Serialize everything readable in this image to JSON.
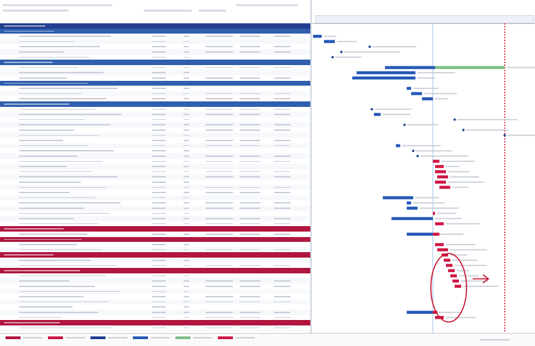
{
  "colors": {
    "section_navy": "#243f8f",
    "section_blue": "#2f5fae",
    "section_crimson": "#b0163f",
    "task_blue": "#2558b8",
    "milestone_blue": "#1d3e8c",
    "critical_red": "#cf1744",
    "green": "#7fbf8a",
    "today_line": "#8fb6e4",
    "deadline_red": "#e0283e",
    "annotation_red": "#c8102e"
  },
  "icons": {
    "annotation_arrow": "right-arrow-icon",
    "annotation_circle": "circle-highlight"
  },
  "rows": [
    {
      "style": "sec",
      "color": "section_navy",
      "name": "",
      "id": "",
      "data": ""
    },
    {
      "style": "sec",
      "color": "section_blue",
      "name": "",
      "id": "",
      "data": ""
    },
    {
      "style": "task",
      "name": "",
      "id": "",
      "data": ""
    },
    {
      "style": "task",
      "name": "",
      "id": "",
      "data": ""
    },
    {
      "style": "task",
      "name": "",
      "id": "",
      "data": ""
    },
    {
      "style": "task",
      "name": "",
      "id": "",
      "data": ""
    },
    {
      "style": "task",
      "name": "",
      "id": "",
      "data": ""
    },
    {
      "style": "sec",
      "color": "section_blue",
      "name": "",
      "id": "",
      "data": ""
    },
    {
      "style": "task",
      "name": "",
      "id": "",
      "data": ""
    },
    {
      "style": "task",
      "name": "",
      "id": "",
      "data": ""
    },
    {
      "style": "task",
      "name": "",
      "id": "",
      "data": ""
    },
    {
      "style": "sec",
      "color": "section_blue",
      "name": "",
      "id": "",
      "data": ""
    },
    {
      "style": "task",
      "name": "",
      "id": "",
      "data": ""
    },
    {
      "style": "task",
      "name": "",
      "id": "",
      "data": ""
    },
    {
      "style": "task",
      "name": "",
      "id": "",
      "data": ""
    },
    {
      "style": "sec",
      "color": "section_blue",
      "name": "",
      "id": "",
      "data": ""
    },
    {
      "style": "task",
      "name": "",
      "id": "",
      "data": ""
    },
    {
      "style": "task",
      "name": "",
      "id": "",
      "data": ""
    },
    {
      "style": "task",
      "name": "",
      "id": "",
      "data": ""
    },
    {
      "style": "task",
      "name": "",
      "id": "",
      "data": ""
    },
    {
      "style": "task",
      "name": "",
      "id": "",
      "data": ""
    },
    {
      "style": "task",
      "name": "",
      "id": "",
      "data": ""
    },
    {
      "style": "task",
      "name": "",
      "id": "",
      "data": ""
    },
    {
      "style": "task",
      "name": "",
      "id": "",
      "data": ""
    },
    {
      "style": "task",
      "name": "",
      "id": "",
      "data": ""
    },
    {
      "style": "task",
      "name": "",
      "id": "",
      "data": ""
    },
    {
      "style": "task",
      "name": "",
      "id": "",
      "data": ""
    },
    {
      "style": "task",
      "name": "",
      "id": "",
      "data": ""
    },
    {
      "style": "task",
      "name": "",
      "id": "",
      "data": ""
    },
    {
      "style": "task",
      "name": "",
      "id": "",
      "data": ""
    },
    {
      "style": "task",
      "name": "",
      "id": "",
      "data": ""
    },
    {
      "style": "task",
      "name": "",
      "id": "",
      "data": ""
    },
    {
      "style": "task",
      "name": "",
      "id": "",
      "data": ""
    },
    {
      "style": "task",
      "name": "",
      "id": "",
      "data": ""
    },
    {
      "style": "task",
      "name": "",
      "id": "",
      "data": ""
    },
    {
      "style": "task",
      "name": "",
      "id": "",
      "data": ""
    },
    {
      "style": "task",
      "name": "",
      "id": "",
      "data": ""
    },
    {
      "style": "task",
      "name": "",
      "id": "",
      "data": ""
    },
    {
      "style": "task",
      "name": "",
      "id": "",
      "data": ""
    },
    {
      "style": "sec",
      "color": "section_crimson",
      "name": "",
      "id": "",
      "data": ""
    },
    {
      "style": "task",
      "name": "",
      "id": "",
      "data": ""
    },
    {
      "style": "sec",
      "color": "section_crimson",
      "name": "",
      "id": "",
      "data": ""
    },
    {
      "style": "task",
      "name": "",
      "id": "",
      "data": ""
    },
    {
      "style": "task",
      "name": "",
      "id": "",
      "data": ""
    },
    {
      "style": "sec",
      "color": "section_crimson",
      "name": "",
      "id": "",
      "data": ""
    },
    {
      "style": "task",
      "name": "",
      "id": "",
      "data": ""
    },
    {
      "style": "task",
      "name": "",
      "id": "",
      "data": ""
    },
    {
      "style": "sec",
      "color": "section_crimson",
      "name": "",
      "id": "",
      "data": ""
    },
    {
      "style": "task",
      "name": "",
      "id": "",
      "data": ""
    },
    {
      "style": "task",
      "name": "",
      "id": "",
      "data": ""
    },
    {
      "style": "task",
      "name": "",
      "id": "",
      "data": ""
    },
    {
      "style": "task",
      "name": "",
      "id": "",
      "data": ""
    },
    {
      "style": "task",
      "name": "",
      "id": "",
      "data": ""
    },
    {
      "style": "task",
      "name": "",
      "id": "",
      "data": ""
    },
    {
      "style": "task",
      "name": "",
      "id": "",
      "data": ""
    },
    {
      "style": "task",
      "name": "",
      "id": "",
      "data": ""
    },
    {
      "style": "task",
      "name": "",
      "id": "",
      "data": ""
    },
    {
      "style": "sec",
      "color": "section_crimson",
      "name": "",
      "id": "",
      "data": ""
    },
    {
      "style": "task",
      "name": "",
      "id": "",
      "data": ""
    }
  ],
  "gantt": [
    {
      "row": 2,
      "color": "task_blue",
      "start": 0.0,
      "end": 0.04,
      "kind": "bar"
    },
    {
      "row": 3,
      "color": "task_blue",
      "start": 0.05,
      "end": 0.1,
      "kind": "bar"
    },
    {
      "row": 4,
      "color": "milestone_blue",
      "start": 0.26,
      "end": 0.26,
      "kind": "milestone"
    },
    {
      "row": 5,
      "color": "milestone_blue",
      "start": 0.13,
      "end": 0.13,
      "kind": "milestone"
    },
    {
      "row": 6,
      "color": "milestone_blue",
      "start": 0.09,
      "end": 0.09,
      "kind": "milestone"
    },
    {
      "row": 8,
      "color": "task_blue",
      "start": 0.33,
      "end": 0.56,
      "kind": "bar"
    },
    {
      "row": 8,
      "color": "green",
      "start": 0.56,
      "end": 0.88,
      "kind": "bar"
    },
    {
      "row": 9,
      "color": "task_blue",
      "start": 0.2,
      "end": 0.47,
      "kind": "bar"
    },
    {
      "row": 10,
      "color": "task_blue",
      "start": 0.18,
      "end": 0.47,
      "kind": "bar"
    },
    {
      "row": 12,
      "color": "task_blue",
      "start": 0.43,
      "end": 0.45,
      "kind": "bar"
    },
    {
      "row": 13,
      "color": "task_blue",
      "start": 0.45,
      "end": 0.5,
      "kind": "bar"
    },
    {
      "row": 14,
      "color": "task_blue",
      "start": 0.5,
      "end": 0.55,
      "kind": "bar"
    },
    {
      "row": 16,
      "color": "milestone_blue",
      "start": 0.27,
      "end": 0.27,
      "kind": "milestone"
    },
    {
      "row": 17,
      "color": "task_blue",
      "start": 0.28,
      "end": 0.31,
      "kind": "bar"
    },
    {
      "row": 18,
      "color": "milestone_blue",
      "start": 0.65,
      "end": 0.65,
      "kind": "milestone"
    },
    {
      "row": 19,
      "color": "milestone_blue",
      "start": 0.42,
      "end": 0.42,
      "kind": "milestone"
    },
    {
      "row": 20,
      "color": "milestone_blue",
      "start": 0.69,
      "end": 0.69,
      "kind": "milestone"
    },
    {
      "row": 21,
      "color": "milestone_blue",
      "start": 0.88,
      "end": 0.88,
      "kind": "milestone"
    },
    {
      "row": 23,
      "color": "task_blue",
      "start": 0.38,
      "end": 0.4,
      "kind": "bar"
    },
    {
      "row": 24,
      "color": "milestone_blue",
      "start": 0.46,
      "end": 0.46,
      "kind": "milestone"
    },
    {
      "row": 25,
      "color": "milestone_blue",
      "start": 0.48,
      "end": 0.48,
      "kind": "milestone"
    },
    {
      "row": 26,
      "color": "critical_red",
      "start": 0.55,
      "end": 0.58,
      "kind": "bar"
    },
    {
      "row": 27,
      "color": "critical_red",
      "start": 0.56,
      "end": 0.6,
      "kind": "bar"
    },
    {
      "row": 28,
      "color": "critical_red",
      "start": 0.56,
      "end": 0.61,
      "kind": "bar"
    },
    {
      "row": 29,
      "color": "critical_red",
      "start": 0.57,
      "end": 0.62,
      "kind": "bar"
    },
    {
      "row": 30,
      "color": "critical_red",
      "start": 0.56,
      "end": 0.61,
      "kind": "bar"
    },
    {
      "row": 31,
      "color": "critical_red",
      "start": 0.58,
      "end": 0.63,
      "kind": "bar"
    },
    {
      "row": 33,
      "color": "task_blue",
      "start": 0.32,
      "end": 0.46,
      "kind": "bar"
    },
    {
      "row": 34,
      "color": "task_blue",
      "start": 0.43,
      "end": 0.45,
      "kind": "bar"
    },
    {
      "row": 35,
      "color": "task_blue",
      "start": 0.43,
      "end": 0.48,
      "kind": "bar"
    },
    {
      "row": 36,
      "color": "critical_red",
      "start": 0.55,
      "end": 0.56,
      "kind": "bar"
    },
    {
      "row": 37,
      "color": "task_blue",
      "start": 0.36,
      "end": 0.55,
      "kind": "bar"
    },
    {
      "row": 38,
      "color": "critical_red",
      "start": 0.56,
      "end": 0.6,
      "kind": "bar"
    },
    {
      "row": 40,
      "color": "task_blue",
      "start": 0.43,
      "end": 0.55,
      "kind": "bar"
    },
    {
      "row": 40,
      "color": "critical_red",
      "start": 0.55,
      "end": 0.58,
      "kind": "bar"
    },
    {
      "row": 42,
      "color": "critical_red",
      "start": 0.56,
      "end": 0.6,
      "kind": "bar"
    },
    {
      "row": 43,
      "color": "critical_red",
      "start": 0.57,
      "end": 0.62,
      "kind": "bar"
    },
    {
      "row": 44,
      "color": "critical_red",
      "start": 0.59,
      "end": 0.62,
      "kind": "bar"
    },
    {
      "row": 45,
      "color": "critical_red",
      "start": 0.6,
      "end": 0.63,
      "kind": "bar"
    },
    {
      "row": 46,
      "color": "critical_red",
      "start": 0.61,
      "end": 0.64,
      "kind": "bar"
    },
    {
      "row": 47,
      "color": "critical_red",
      "start": 0.62,
      "end": 0.65,
      "kind": "bar"
    },
    {
      "row": 48,
      "color": "critical_red",
      "start": 0.63,
      "end": 0.66,
      "kind": "bar"
    },
    {
      "row": 49,
      "color": "critical_red",
      "start": 0.64,
      "end": 0.67,
      "kind": "bar"
    },
    {
      "row": 50,
      "color": "critical_red",
      "start": 0.65,
      "end": 0.68,
      "kind": "bar"
    },
    {
      "row": 55,
      "color": "task_blue",
      "start": 0.43,
      "end": 0.55,
      "kind": "bar"
    },
    {
      "row": 55,
      "color": "critical_red",
      "start": 0.55,
      "end": 0.57,
      "kind": "bar"
    },
    {
      "row": 56,
      "color": "critical_red",
      "start": 0.56,
      "end": 0.6,
      "kind": "bar"
    }
  ],
  "timeline": {
    "today_fraction": 0.55,
    "deadline_fraction": 0.88
  },
  "legend": [
    {
      "color": "section_crimson"
    },
    {
      "color": "critical_red"
    },
    {
      "color": "milestone_blue"
    },
    {
      "color": "task_blue"
    },
    {
      "color": "green"
    },
    {
      "color": "critical_red"
    }
  ]
}
